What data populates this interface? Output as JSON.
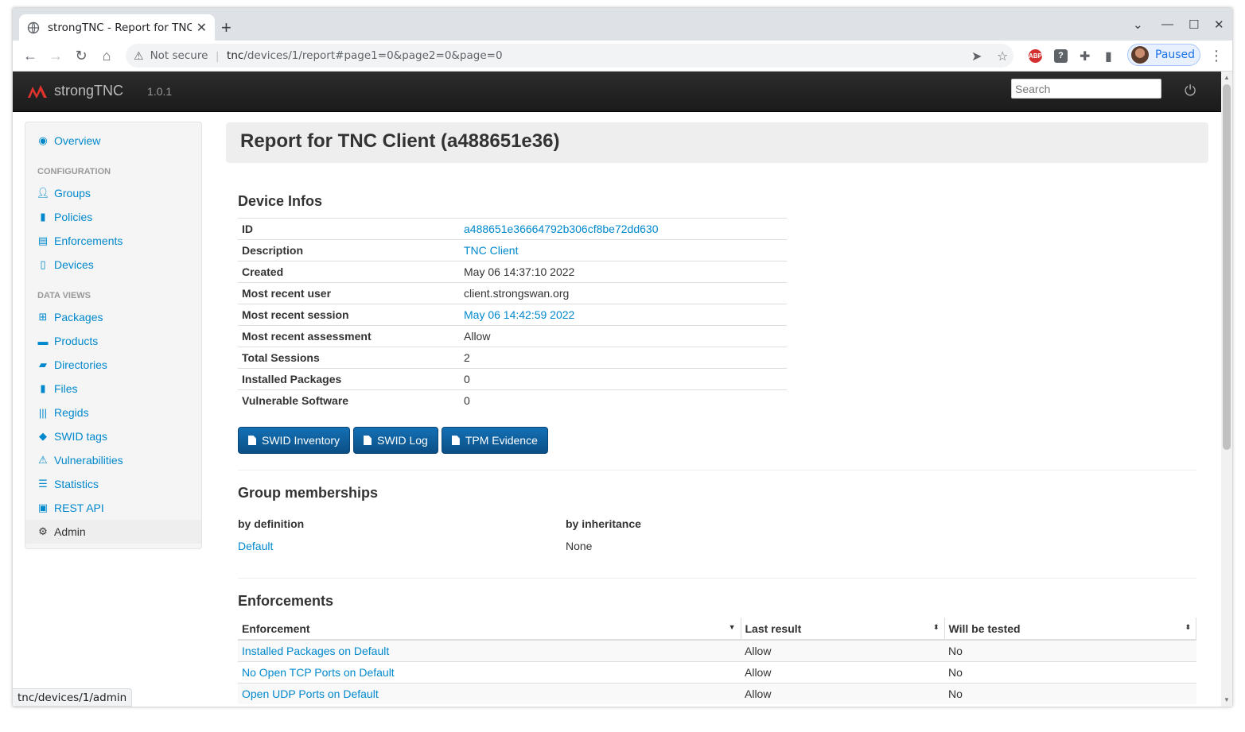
{
  "browser": {
    "tab_title": "strongTNC - Report for TNC",
    "security_label": "Not secure",
    "url_host": "tnc",
    "url_path": "/devices/1/report#page1=0&page2=0&page=0",
    "profile_label": "Paused",
    "status_url": "tnc/devices/1/admin"
  },
  "app": {
    "name": "strongTNC",
    "version": "1.0.1",
    "search_placeholder": "Search"
  },
  "sidebar": {
    "overview": "Overview",
    "config_header": "Configuration",
    "config_items": [
      "Groups",
      "Policies",
      "Enforcements",
      "Devices"
    ],
    "dataviews_header": "Data Views",
    "data_items": [
      "Packages",
      "Products",
      "Directories",
      "Files",
      "Regids",
      "SWID tags",
      "Vulnerabilities",
      "Statistics",
      "REST API"
    ],
    "admin": "Admin"
  },
  "page": {
    "title": "Report for TNC Client (a488651e36)",
    "device_infos_heading": "Device Infos",
    "device_infos": [
      {
        "key": "ID",
        "value": "a488651e36664792b306cf8be72dd630"
      },
      {
        "key": "Description",
        "value": "TNC Client"
      },
      {
        "key": "Created",
        "value": "May 06 14:37:10 2022"
      },
      {
        "key": "Most recent user",
        "value": "client.strongswan.org"
      },
      {
        "key": "Most recent session",
        "value": "May 06 14:42:59 2022"
      },
      {
        "key": "Most recent assessment",
        "value": "Allow"
      },
      {
        "key": "Total Sessions",
        "value": "2"
      },
      {
        "key": "Installed Packages",
        "value": "0"
      },
      {
        "key": "Vulnerable Software",
        "value": "0"
      }
    ],
    "buttons": [
      "SWID Inventory",
      "SWID Log",
      "TPM Evidence"
    ],
    "groups_heading": "Group memberships",
    "by_definition_label": "by definition",
    "by_definition_value": "Default",
    "by_inheritance_label": "by inheritance",
    "by_inheritance_value": "None",
    "enforcements_heading": "Enforcements",
    "enf_columns": [
      "Enforcement",
      "Last result",
      "Will be tested"
    ],
    "enf_rows": [
      [
        "Installed Packages on Default",
        "Allow",
        "No"
      ],
      [
        "No Open TCP Ports on Default",
        "Allow",
        "No"
      ],
      [
        "Open UDP Ports on Default",
        "Allow",
        "No"
      ]
    ]
  }
}
